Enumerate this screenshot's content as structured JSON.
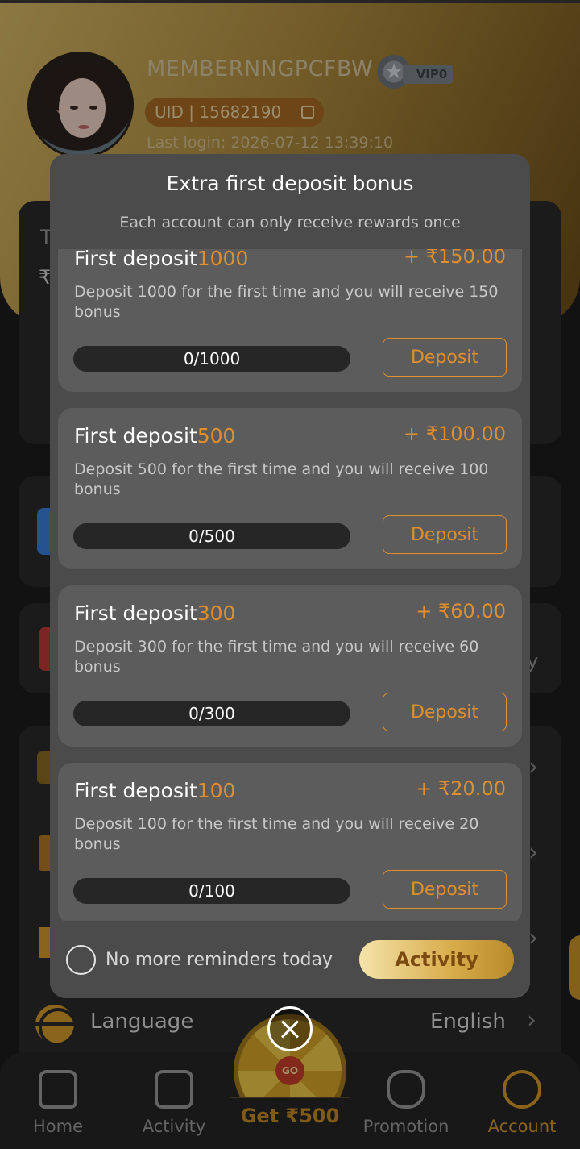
{
  "profile": {
    "username": "MEMBERNNGPCFBW",
    "vip_label": "VIP0",
    "uid_text": "UID  |  15682190",
    "last_login": "Last login: 2026-07-12 13:39:10"
  },
  "background_fragments": {
    "wallet_initial": "T",
    "currency_symbol": "₹",
    "side_fragment": "y"
  },
  "language_row": {
    "label": "Language",
    "value": "English"
  },
  "modal": {
    "title": "Extra first deposit bonus",
    "subtitle": "Each account can only receive rewards once",
    "cards": [
      {
        "title_prefix": "First deposit",
        "amount": "1000",
        "bonus": "+ ₹150.00",
        "description": "Deposit 1000 for the first time and you will receive 150 bonus",
        "progress": "0/1000",
        "button": "Deposit"
      },
      {
        "title_prefix": "First deposit",
        "amount": "500",
        "bonus": "+ ₹100.00",
        "description": "Deposit 500 for the first time and you will receive 100 bonus",
        "progress": "0/500",
        "button": "Deposit"
      },
      {
        "title_prefix": "First deposit",
        "amount": "300",
        "bonus": "+ ₹60.00",
        "description": "Deposit 300 for the first time and you will receive 60 bonus",
        "progress": "0/300",
        "button": "Deposit"
      },
      {
        "title_prefix": "First deposit",
        "amount": "100",
        "bonus": "+ ₹20.00",
        "description": "Deposit 100 for the first time and you will receive 20 bonus",
        "progress": "0/100",
        "button": "Deposit"
      }
    ],
    "reminder_label": "No more reminders today",
    "activity_button": "Activity"
  },
  "wheel": {
    "go_label": "GO",
    "get_label": "Get ₹500"
  },
  "bottom_nav": {
    "home": "Home",
    "activity": "Activity",
    "promotion": "Promotion",
    "account": "Account"
  },
  "colors": {
    "accent_orange": "#e08f2c",
    "modal_bg": "#4b4b4b",
    "card_bg": "#5c5c5c"
  }
}
